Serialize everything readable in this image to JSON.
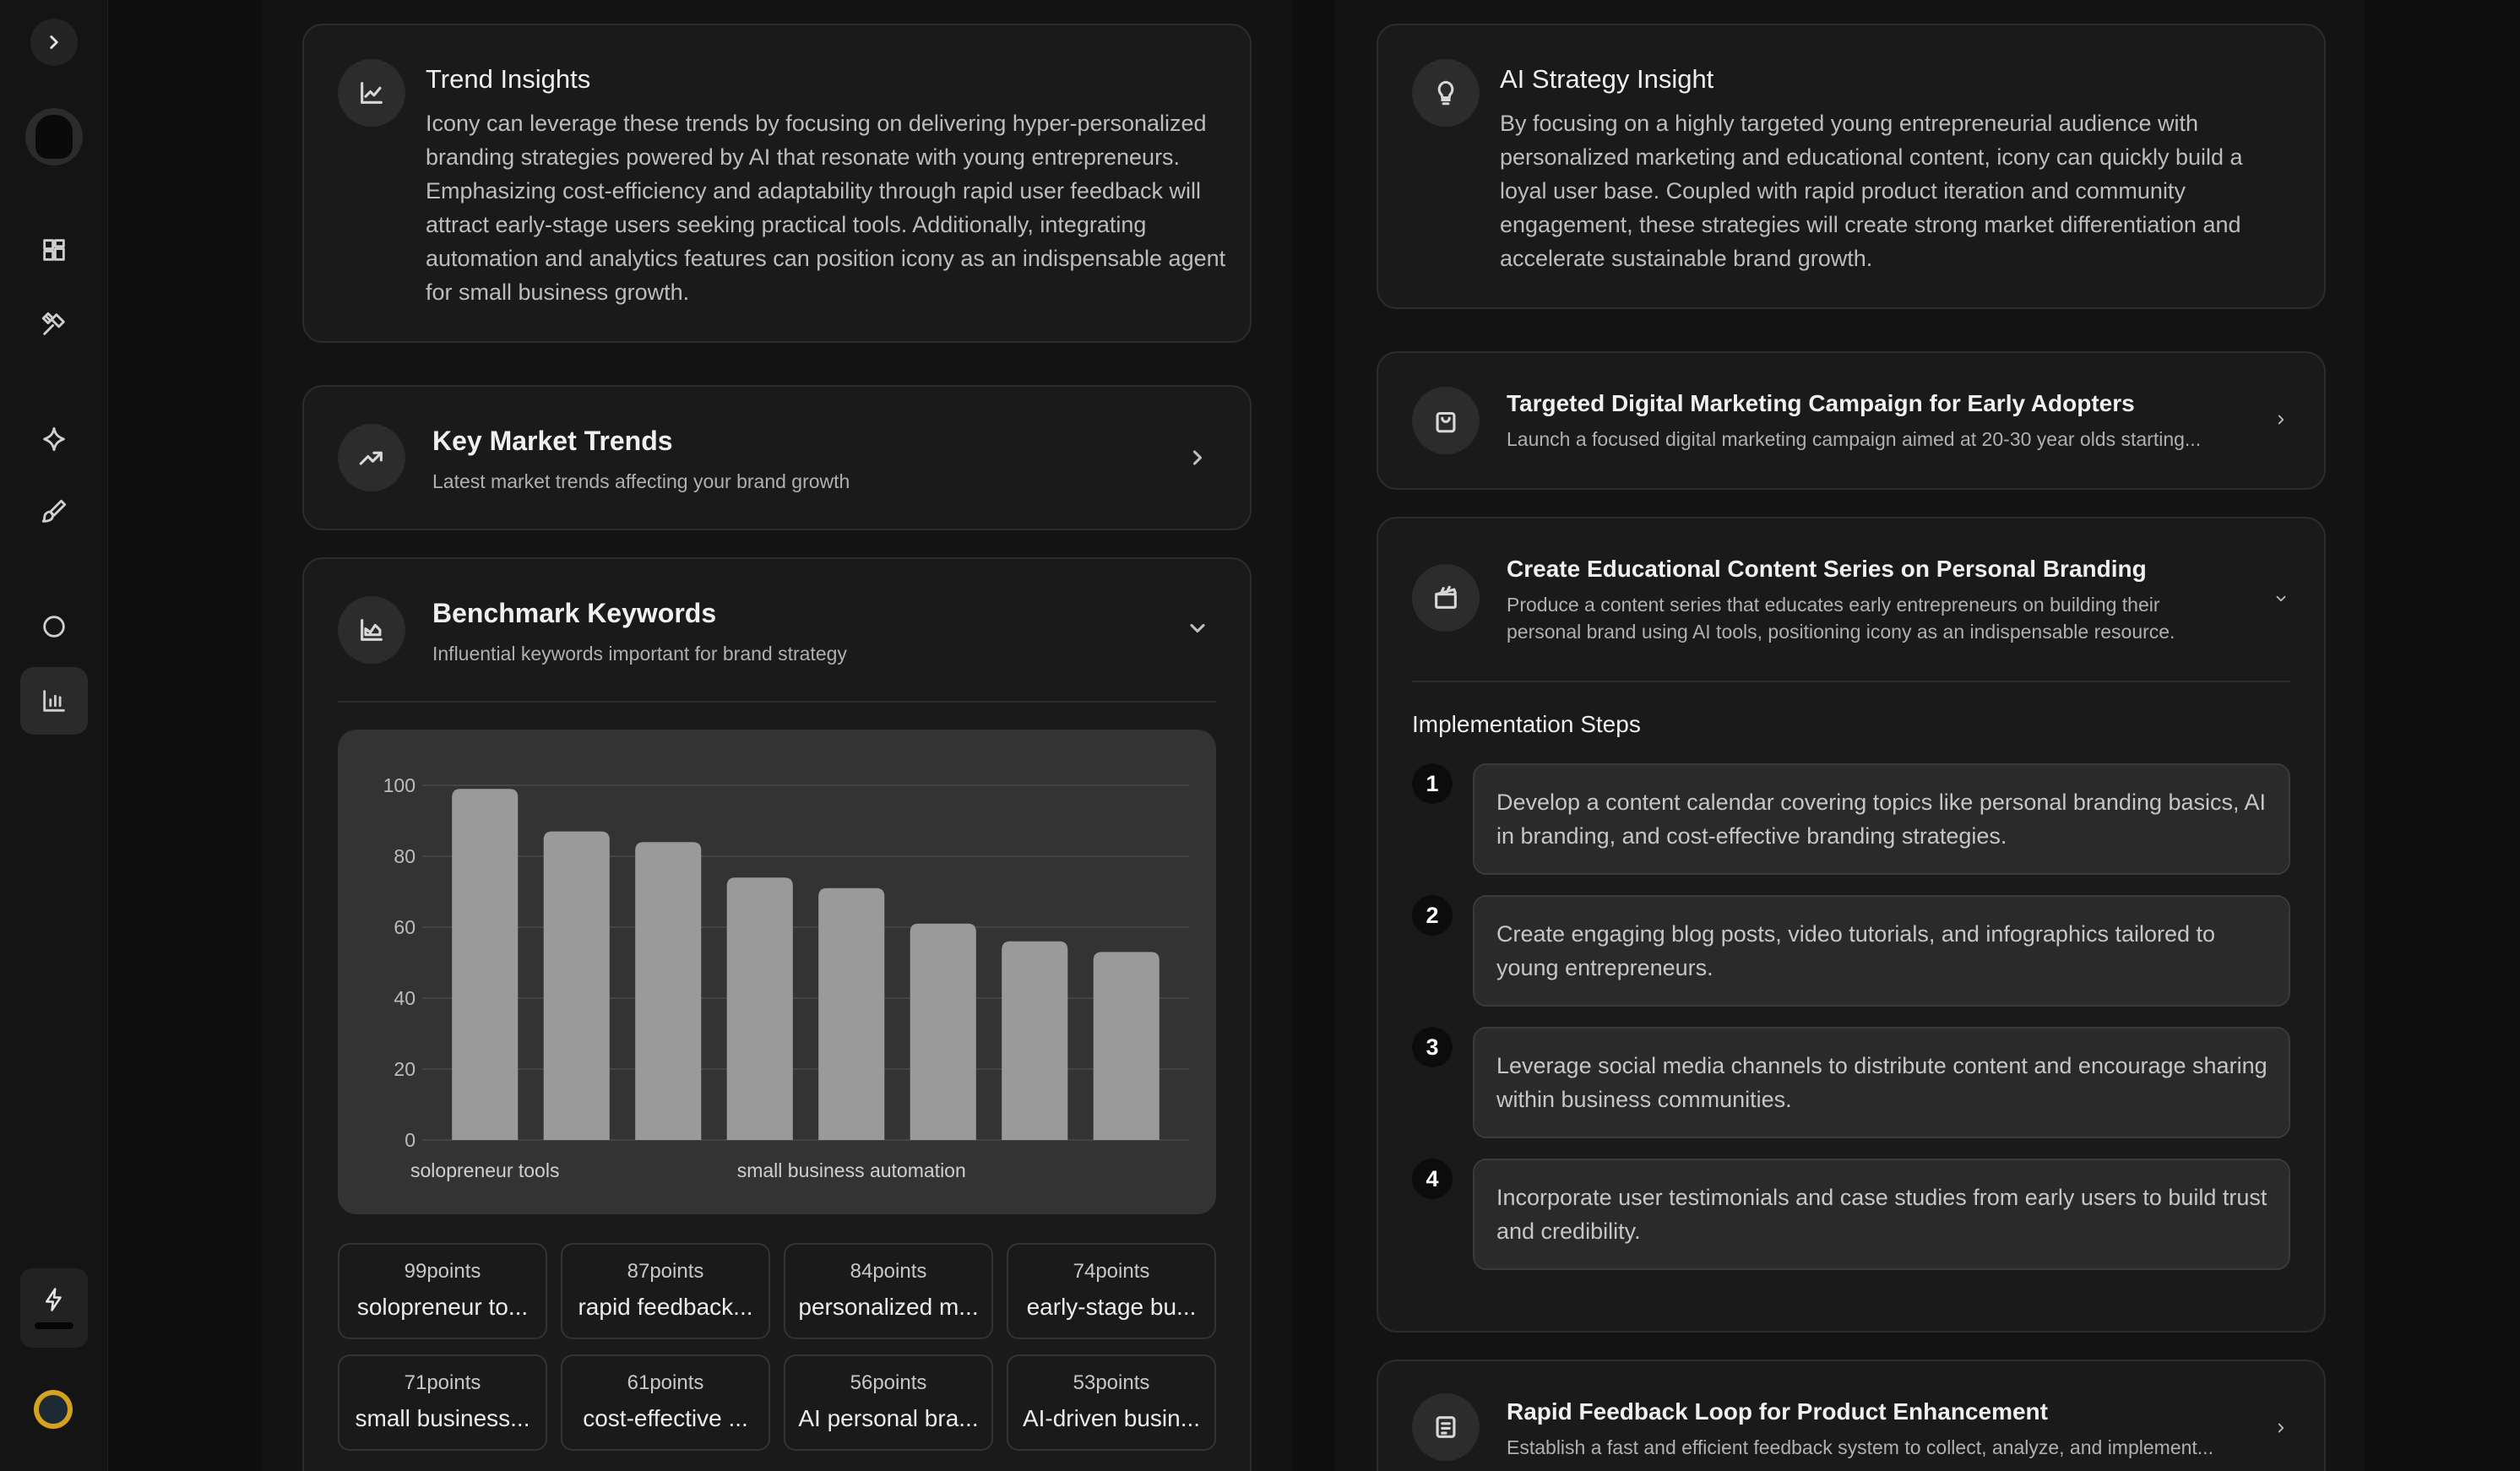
{
  "trend_insights": {
    "title": "Trend Insights",
    "body": "Icony can leverage these trends by focusing on delivering hyper-personalized branding strategies powered by AI that resonate with young entrepreneurs. Emphasizing cost-efficiency and adaptability through rapid user feedback will attract early-stage users seeking practical tools. Additionally, integrating automation and analytics features can position icony as an indispensable agent for small business growth."
  },
  "key_market_trends": {
    "title": "Key Market Trends",
    "subtitle": "Latest market trends affecting your brand growth"
  },
  "benchmark_keywords": {
    "title": "Benchmark Keywords",
    "subtitle": "Influential keywords important for brand strategy",
    "tiles": [
      {
        "points": "99points",
        "keyword": "solopreneur to..."
      },
      {
        "points": "87points",
        "keyword": "rapid feedback..."
      },
      {
        "points": "84points",
        "keyword": "personalized m..."
      },
      {
        "points": "74points",
        "keyword": "early-stage bu..."
      },
      {
        "points": "71points",
        "keyword": "small business..."
      },
      {
        "points": "61points",
        "keyword": "cost-effective ..."
      },
      {
        "points": "56points",
        "keyword": "AI personal bra..."
      },
      {
        "points": "53points",
        "keyword": "AI-driven busin..."
      }
    ]
  },
  "chart_data": {
    "type": "bar",
    "categories": [
      "solopreneur tools",
      "",
      "",
      "",
      "small business automation",
      "",
      "",
      ""
    ],
    "values": [
      99,
      87,
      84,
      74,
      71,
      61,
      56,
      53
    ],
    "ylim": [
      0,
      100
    ],
    "yticks": [
      "0",
      "20",
      "40",
      "60",
      "80",
      "100"
    ],
    "grid": true,
    "bar_color": "#9a9a9a"
  },
  "ai_strategy": {
    "title": "AI Strategy Insight",
    "body": "By focusing on a highly targeted young entrepreneurial audience with personalized marketing and educational content, icony can quickly build a loyal user base. Coupled with rapid product iteration and community engagement, these strategies will create strong market differentiation and accelerate sustainable brand growth."
  },
  "strategies": [
    {
      "title": "Targeted Digital Marketing Campaign for Early Adopters",
      "desc": "Launch a focused digital marketing campaign aimed at 20-30 year olds starting..."
    },
    {
      "title": "Create Educational Content Series on Personal Branding",
      "desc": "Produce a content series that educates early entrepreneurs on building their personal brand using AI tools, positioning icony as an indispensable resource."
    },
    {
      "title": "Rapid Feedback Loop for Product Enhancement",
      "desc": "Establish a fast and efficient feedback system to collect, analyze, and implement..."
    }
  ],
  "implementation": {
    "title": "Implementation Steps",
    "steps": [
      {
        "num": "1",
        "text": "Develop a content calendar covering topics like personal branding basics, AI in branding, and cost-effective branding strategies."
      },
      {
        "num": "2",
        "text": "Create engaging blog posts, video tutorials, and infographics tailored to young entrepreneurs."
      },
      {
        "num": "3",
        "text": "Leverage social media channels to distribute content and encourage sharing within business communities."
      },
      {
        "num": "4",
        "text": "Incorporate user testimonials and case studies from early users to build trust and credibility."
      }
    ]
  }
}
